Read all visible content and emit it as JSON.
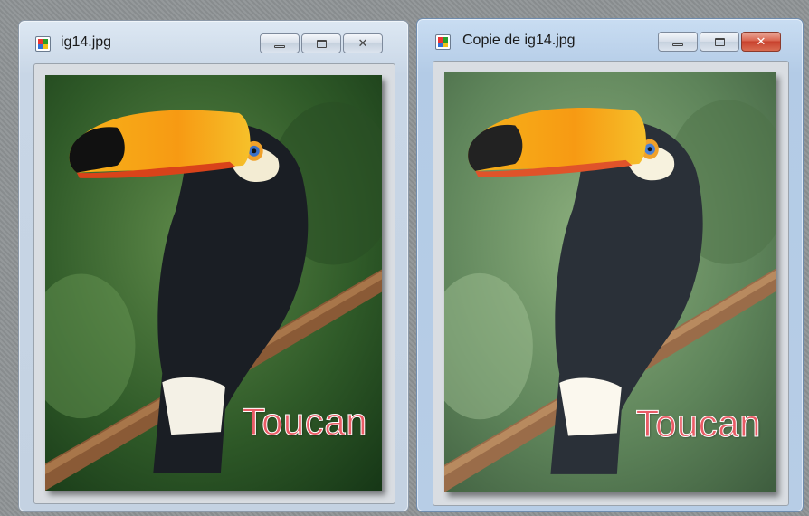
{
  "windows": [
    {
      "title": "ig14.jpg",
      "image_caption": "Toucan",
      "active": false
    },
    {
      "title": "Copie de ig14.jpg",
      "image_caption": "Toucan",
      "active": true
    }
  ],
  "icons": {
    "app": "image-file-icon",
    "minimize": "minimize-icon",
    "maximize": "maximize-icon",
    "close": "close-icon"
  },
  "colors": {
    "caption": "#e95c66",
    "close_active": "#c8412d"
  }
}
